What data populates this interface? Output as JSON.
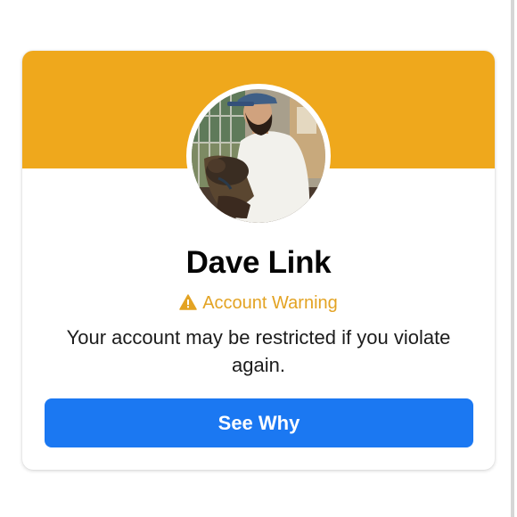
{
  "profile": {
    "name": "Dave Link",
    "avatar_alt": "profile-photo"
  },
  "warning": {
    "icon": "warning-triangle-icon",
    "label": "Account Warning"
  },
  "message": "Your account may be restricted if you violate again.",
  "actions": {
    "see_why_label": "See Why"
  },
  "colors": {
    "banner": "#efa81c",
    "warning_text": "#e3a323",
    "primary_button": "#1b78f2",
    "name_text": "#050505"
  }
}
